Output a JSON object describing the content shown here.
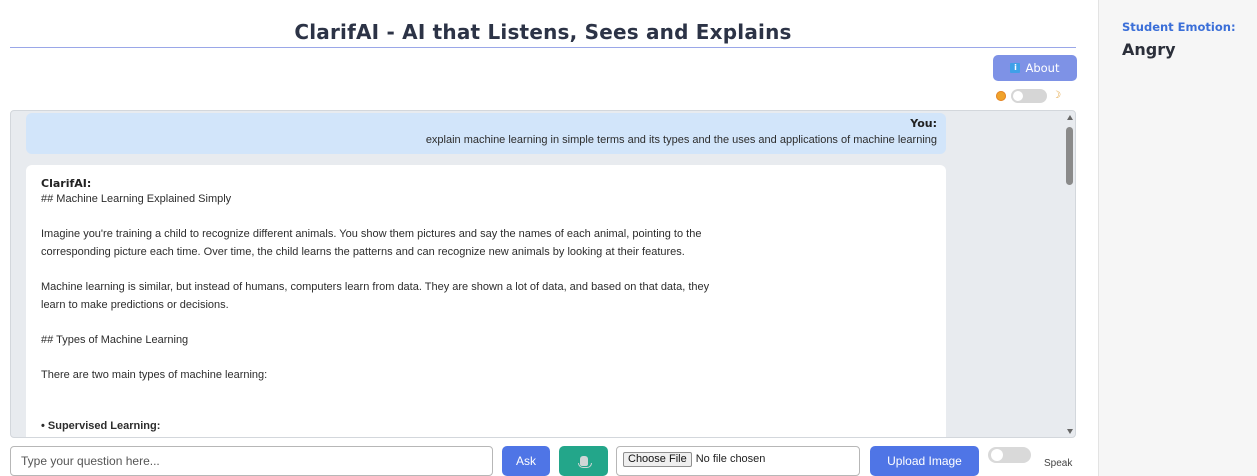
{
  "app": {
    "title": "ClarifAI - AI that Listens, Sees and Explains"
  },
  "header": {
    "about_label": "About",
    "about_icon": "info-icon",
    "theme_toggle": {
      "left_icon": "sun-icon",
      "right_icon": "moon-icon",
      "on": false
    }
  },
  "chat": {
    "user": {
      "label": "You:",
      "text": "explain machine learning in simple terms and its types and the uses and applications of machine learning"
    },
    "ai": {
      "label": "ClarifAI:",
      "lines": {
        "l1": "## Machine Learning Explained Simply",
        "l2": "Imagine you're training a child to recognize different animals. You show them pictures and say the names of each animal, pointing to the",
        "l3": "corresponding picture each time. Over time, the child learns the patterns and can recognize new animals by looking at their features.",
        "l4": "Machine learning is similar, but instead of humans, computers learn from data. They are shown a lot of data, and based on that data, they",
        "l5": "learn to make predictions or decisions.",
        "l6": "## Types of Machine Learning",
        "l7": "There are two main types of machine learning:",
        "l8": "• Supervised Learning:"
      }
    }
  },
  "input_bar": {
    "question_placeholder": "Type your question here...",
    "ask_label": "Ask",
    "mic_icon": "microphone-icon",
    "choose_file_label": "Choose File",
    "no_file_text": "No file chosen",
    "upload_label": "Upload Image",
    "speak_label": "Speak",
    "speak_on": false
  },
  "sidebar": {
    "emotion_label": "Student Emotion:",
    "emotion_value": "Angry"
  },
  "colors": {
    "accent": "#4f75e6",
    "about": "#7e92e6",
    "mic": "#23a68a",
    "user_bubble": "#d2e5fa",
    "emotion_label": "#3b6fd8"
  }
}
